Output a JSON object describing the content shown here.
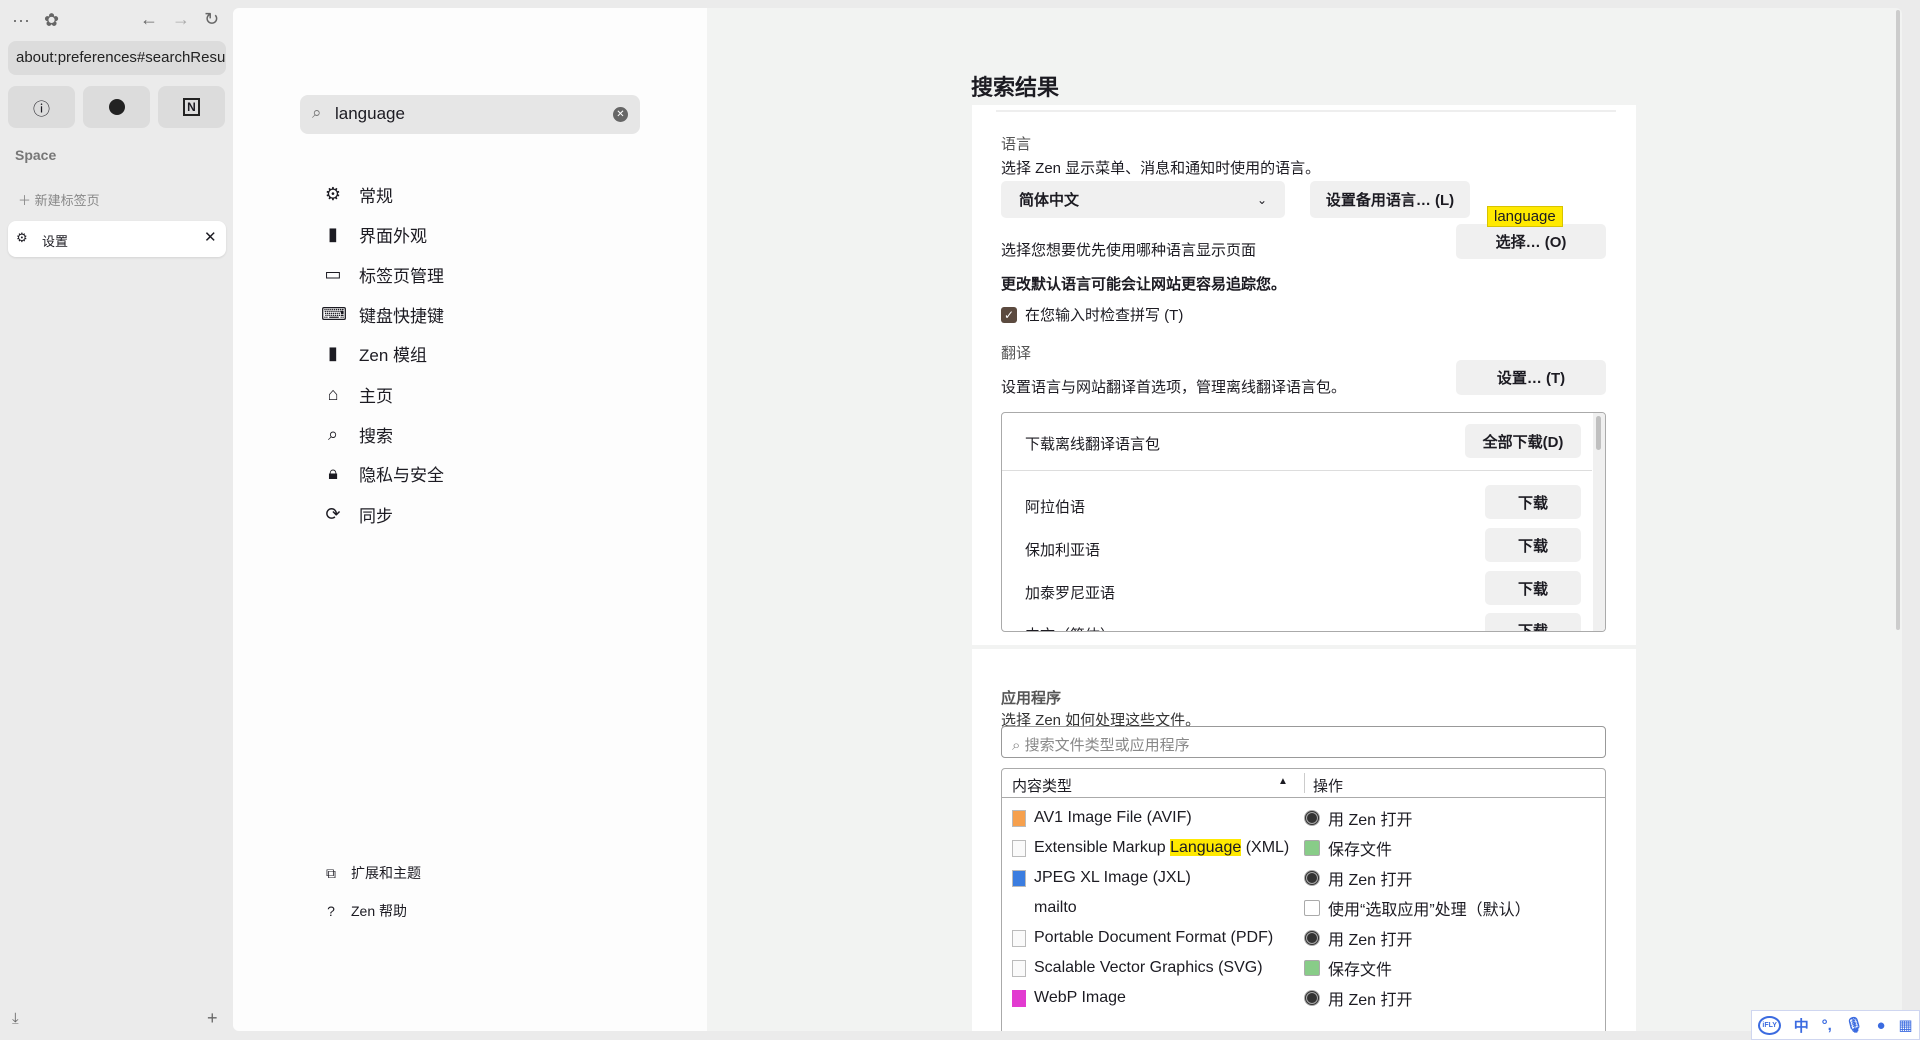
{
  "browser": {
    "url": "about:preferences#searchResults",
    "space_label": "Space",
    "new_tab_label": "新建标签页",
    "tab_label": "设置"
  },
  "prefs": {
    "search_value": "language",
    "nav": [
      "常规",
      "界面外观",
      "标签页管理",
      "键盘快捷键",
      "Zen 模组",
      "主页",
      "搜索",
      "隐私与安全",
      "同步"
    ],
    "bottom_nav": [
      "扩展和主题",
      "Zen 帮助"
    ],
    "title": "搜索结果",
    "language": {
      "heading": "语言",
      "desc": "选择 Zen 显示菜单、消息和通知时使用的语言。",
      "selected": "简体中文",
      "alt_button": "设置备用语言… (L)",
      "page_lang_desc": "选择您想要优先使用哪种语言显示页面",
      "choose_button": "选择… (O)",
      "tooltip": "language",
      "warning": "更改默认语言可能会让网站更容易追踪您。",
      "spellcheck_label": "在您输入时检查拼写 (T)",
      "spellcheck_checked": true
    },
    "translation": {
      "heading": "翻译",
      "desc": "设置语言与网站翻译首选项，管理离线翻译语言包。",
      "settings_button": "设置… (T)",
      "download_header": "下载离线翻译语言包",
      "download_all": "全部下载(D)",
      "download_label": "下载",
      "languages": [
        "阿拉伯语",
        "保加利亚语",
        "加泰罗尼亚语",
        "中文（简体）"
      ]
    },
    "apps": {
      "heading": "应用程序",
      "desc": "选择 Zen 如何处理这些文件。",
      "search_placeholder": "搜索文件类型或应用程序",
      "col_type": "内容类型",
      "col_action": "操作",
      "rows": [
        {
          "pre": "AV1 Image File (AVIF)",
          "hl": "",
          "post": "",
          "action": "用 Zen 打开",
          "icon": "avif-file-icon",
          "aicon": "zen-icon"
        },
        {
          "pre": "Extensible Markup ",
          "hl": "Language",
          "post": " (XML)",
          "action": "保存文件",
          "icon": "file-icon",
          "aicon": "save-icon"
        },
        {
          "pre": "JPEG XL Image (JXL)",
          "hl": "",
          "post": "",
          "action": "用 Zen 打开",
          "icon": "image-file-icon",
          "aicon": "zen-icon"
        },
        {
          "pre": "mailto",
          "hl": "",
          "post": "",
          "action": "使用“选取应用”处理（默认）",
          "icon": "",
          "aicon": "app-icon"
        },
        {
          "pre": "Portable Document Format (PDF)",
          "hl": "",
          "post": "",
          "action": "用 Zen 打开",
          "icon": "file-icon",
          "aicon": "zen-icon"
        },
        {
          "pre": "Scalable Vector Graphics (SVG)",
          "hl": "",
          "post": "",
          "action": "保存文件",
          "icon": "file-icon",
          "aicon": "save-icon"
        },
        {
          "pre": "WebP Image",
          "hl": "",
          "post": "",
          "action": "用 Zen 打开",
          "icon": "webp-file-icon",
          "aicon": "zen-icon"
        }
      ]
    }
  },
  "tray": {
    "ime_lang": "中"
  }
}
